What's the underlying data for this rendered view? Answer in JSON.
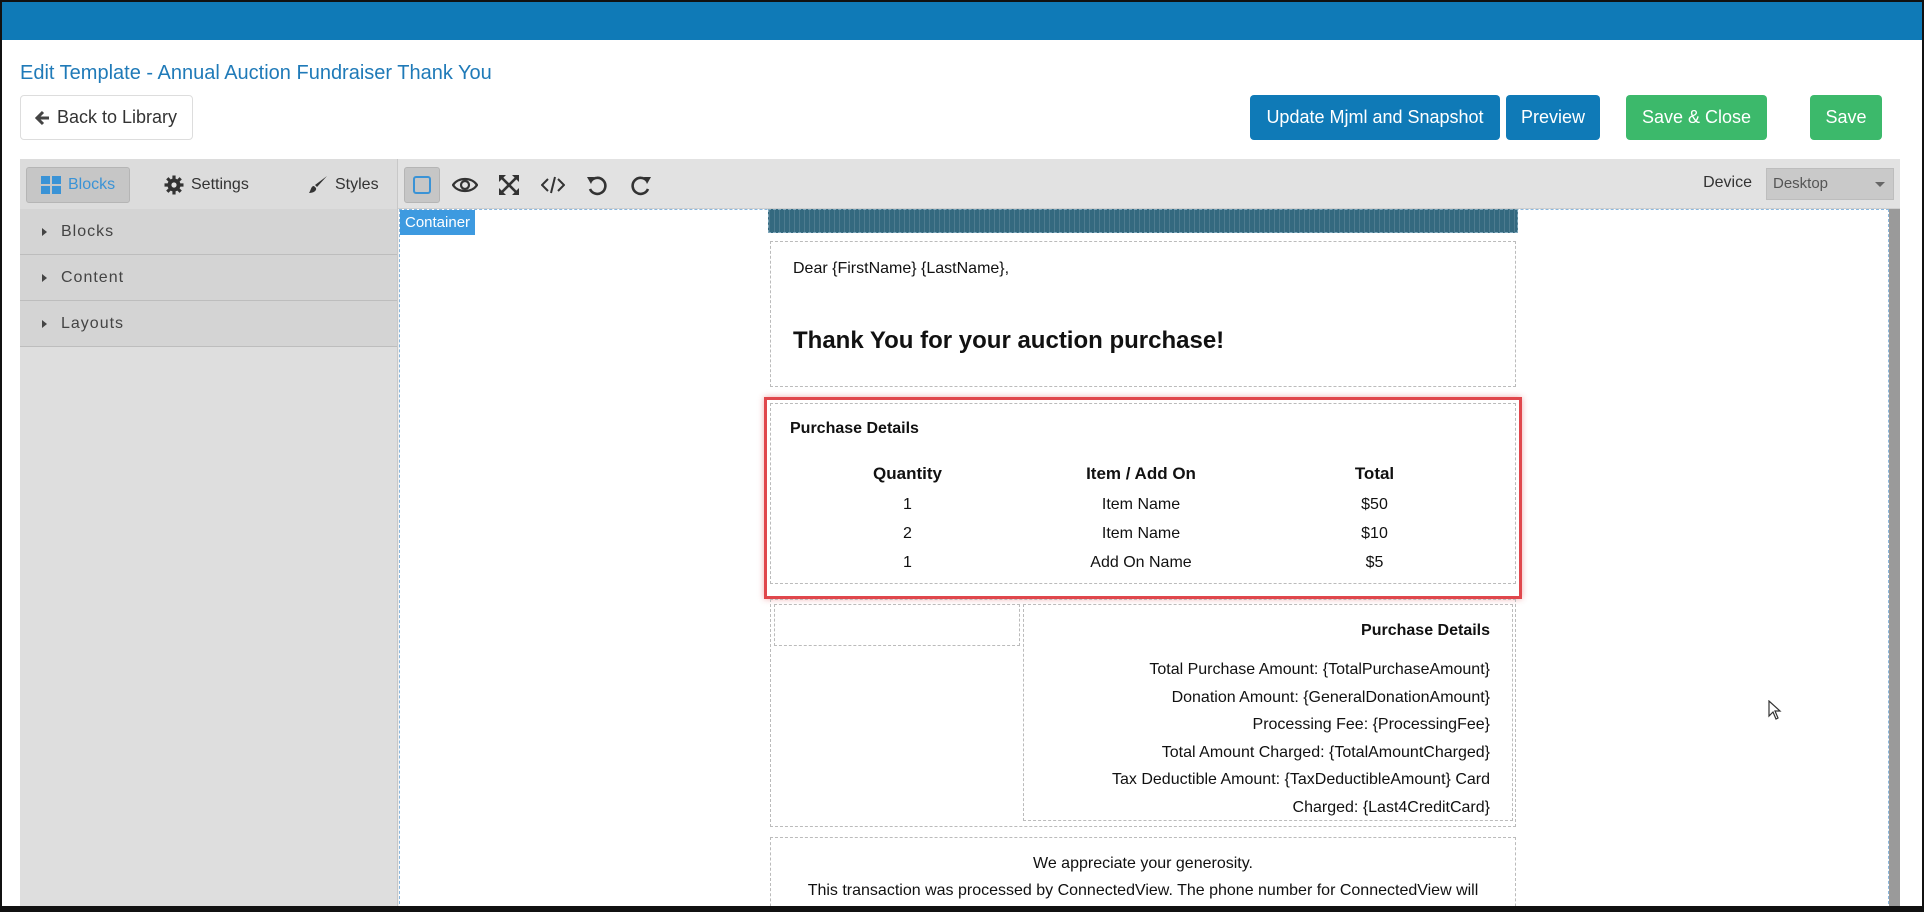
{
  "header": {
    "title": "Edit Template - Annual Auction Fundraiser Thank You",
    "back_label": "Back to Library",
    "buttons": {
      "update": "Update Mjml and Snapshot",
      "preview": "Preview",
      "save_close": "Save & Close",
      "save": "Save"
    },
    "colors": {
      "primary": "#0f7ab7",
      "success": "#3cb96b",
      "highlight": "#e0474c"
    }
  },
  "editor": {
    "tabs": [
      {
        "label": "Blocks",
        "icon": "grid-icon",
        "active": true
      },
      {
        "label": "Settings",
        "icon": "gear-icon",
        "active": false
      },
      {
        "label": "Styles",
        "icon": "brush-icon",
        "active": false
      }
    ],
    "tools": [
      "outline-icon",
      "eye-icon",
      "fullscreen-icon",
      "code-icon",
      "undo-icon",
      "redo-icon"
    ],
    "device_label": "Device",
    "device_value": "Desktop",
    "sidebar": [
      "Blocks",
      "Content",
      "Layouts"
    ],
    "container_badge": "Container"
  },
  "email": {
    "greeting": "Dear {FirstName} {LastName},",
    "thanks": "Thank You for your auction purchase!",
    "purchase_title": "Purchase Details",
    "table": {
      "headers": [
        "Quantity",
        "Item / Add On",
        "Total"
      ],
      "rows": [
        [
          "1",
          "Item Name",
          "$50"
        ],
        [
          "2",
          "Item Name",
          "$10"
        ],
        [
          "1",
          "Add On Name",
          "$5"
        ]
      ]
    },
    "summary_title": "Purchase Details",
    "summary_lines": [
      "Total Purchase Amount: {TotalPurchaseAmount}",
      "Donation Amount: {GeneralDonationAmount}",
      "Processing Fee: {ProcessingFee}",
      "Total Amount Charged: {TotalAmountCharged}",
      "Tax Deductible Amount: {TaxDeductibleAmount} Card",
      "Charged: {Last4CreditCard}"
    ],
    "appreciation": "We appreciate your generosity.",
    "processed": "This transaction was processed by ConnectedView. The phone number for ConnectedView will"
  }
}
